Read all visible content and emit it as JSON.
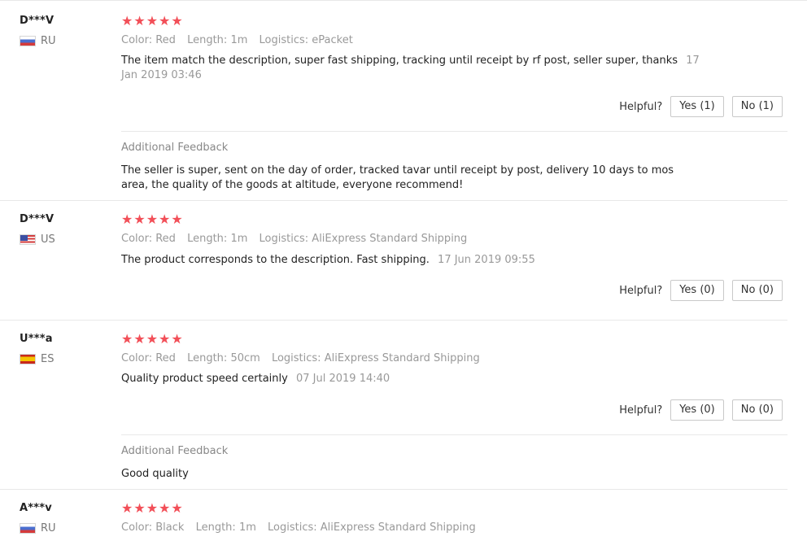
{
  "labels": {
    "color": "Color:",
    "length": "Length:",
    "logistics": "Logistics:",
    "helpful": "Helpful?",
    "additional_feedback": "Additional Feedback"
  },
  "reviews": [
    {
      "user": "D***V",
      "country": "RU",
      "stars": "★★★★★",
      "rating": 5,
      "color": "Red",
      "length": "1m",
      "logistics": "ePacket",
      "text": "The item match the description, super fast shipping, tracking until receipt by rf post, seller super, thanks",
      "date": "17 Jan 2019 03:46",
      "yes": "Yes (1)",
      "no": "No (1)",
      "additional_feedback": "The seller is super, sent on the day of order, tracked tavar until receipt by post, delivery 10 days to mos area, the quality of the goods at altitude, everyone recommend!"
    },
    {
      "user": "D***V",
      "country": "US",
      "stars": "★★★★★",
      "rating": 5,
      "color": "Red",
      "length": "1m",
      "logistics": "AliExpress Standard Shipping",
      "text": "The product corresponds to the description. Fast shipping.",
      "date": "17 Jun 2019 09:55",
      "yes": "Yes (0)",
      "no": "No (0)"
    },
    {
      "user": "U***a",
      "country": "ES",
      "stars": "★★★★★",
      "rating": 5,
      "color": "Red",
      "length": "50cm",
      "logistics": "AliExpress Standard Shipping",
      "text": "Quality product speed certainly",
      "date": "07 Jul 2019 14:40",
      "yes": "Yes (0)",
      "no": "No (0)",
      "additional_feedback": "Good quality"
    },
    {
      "user": "A***v",
      "country": "RU",
      "stars": "★★★★★",
      "rating": 5,
      "color": "Black",
      "length": "1m",
      "logistics": "AliExpress Standard Shipping"
    }
  ]
}
